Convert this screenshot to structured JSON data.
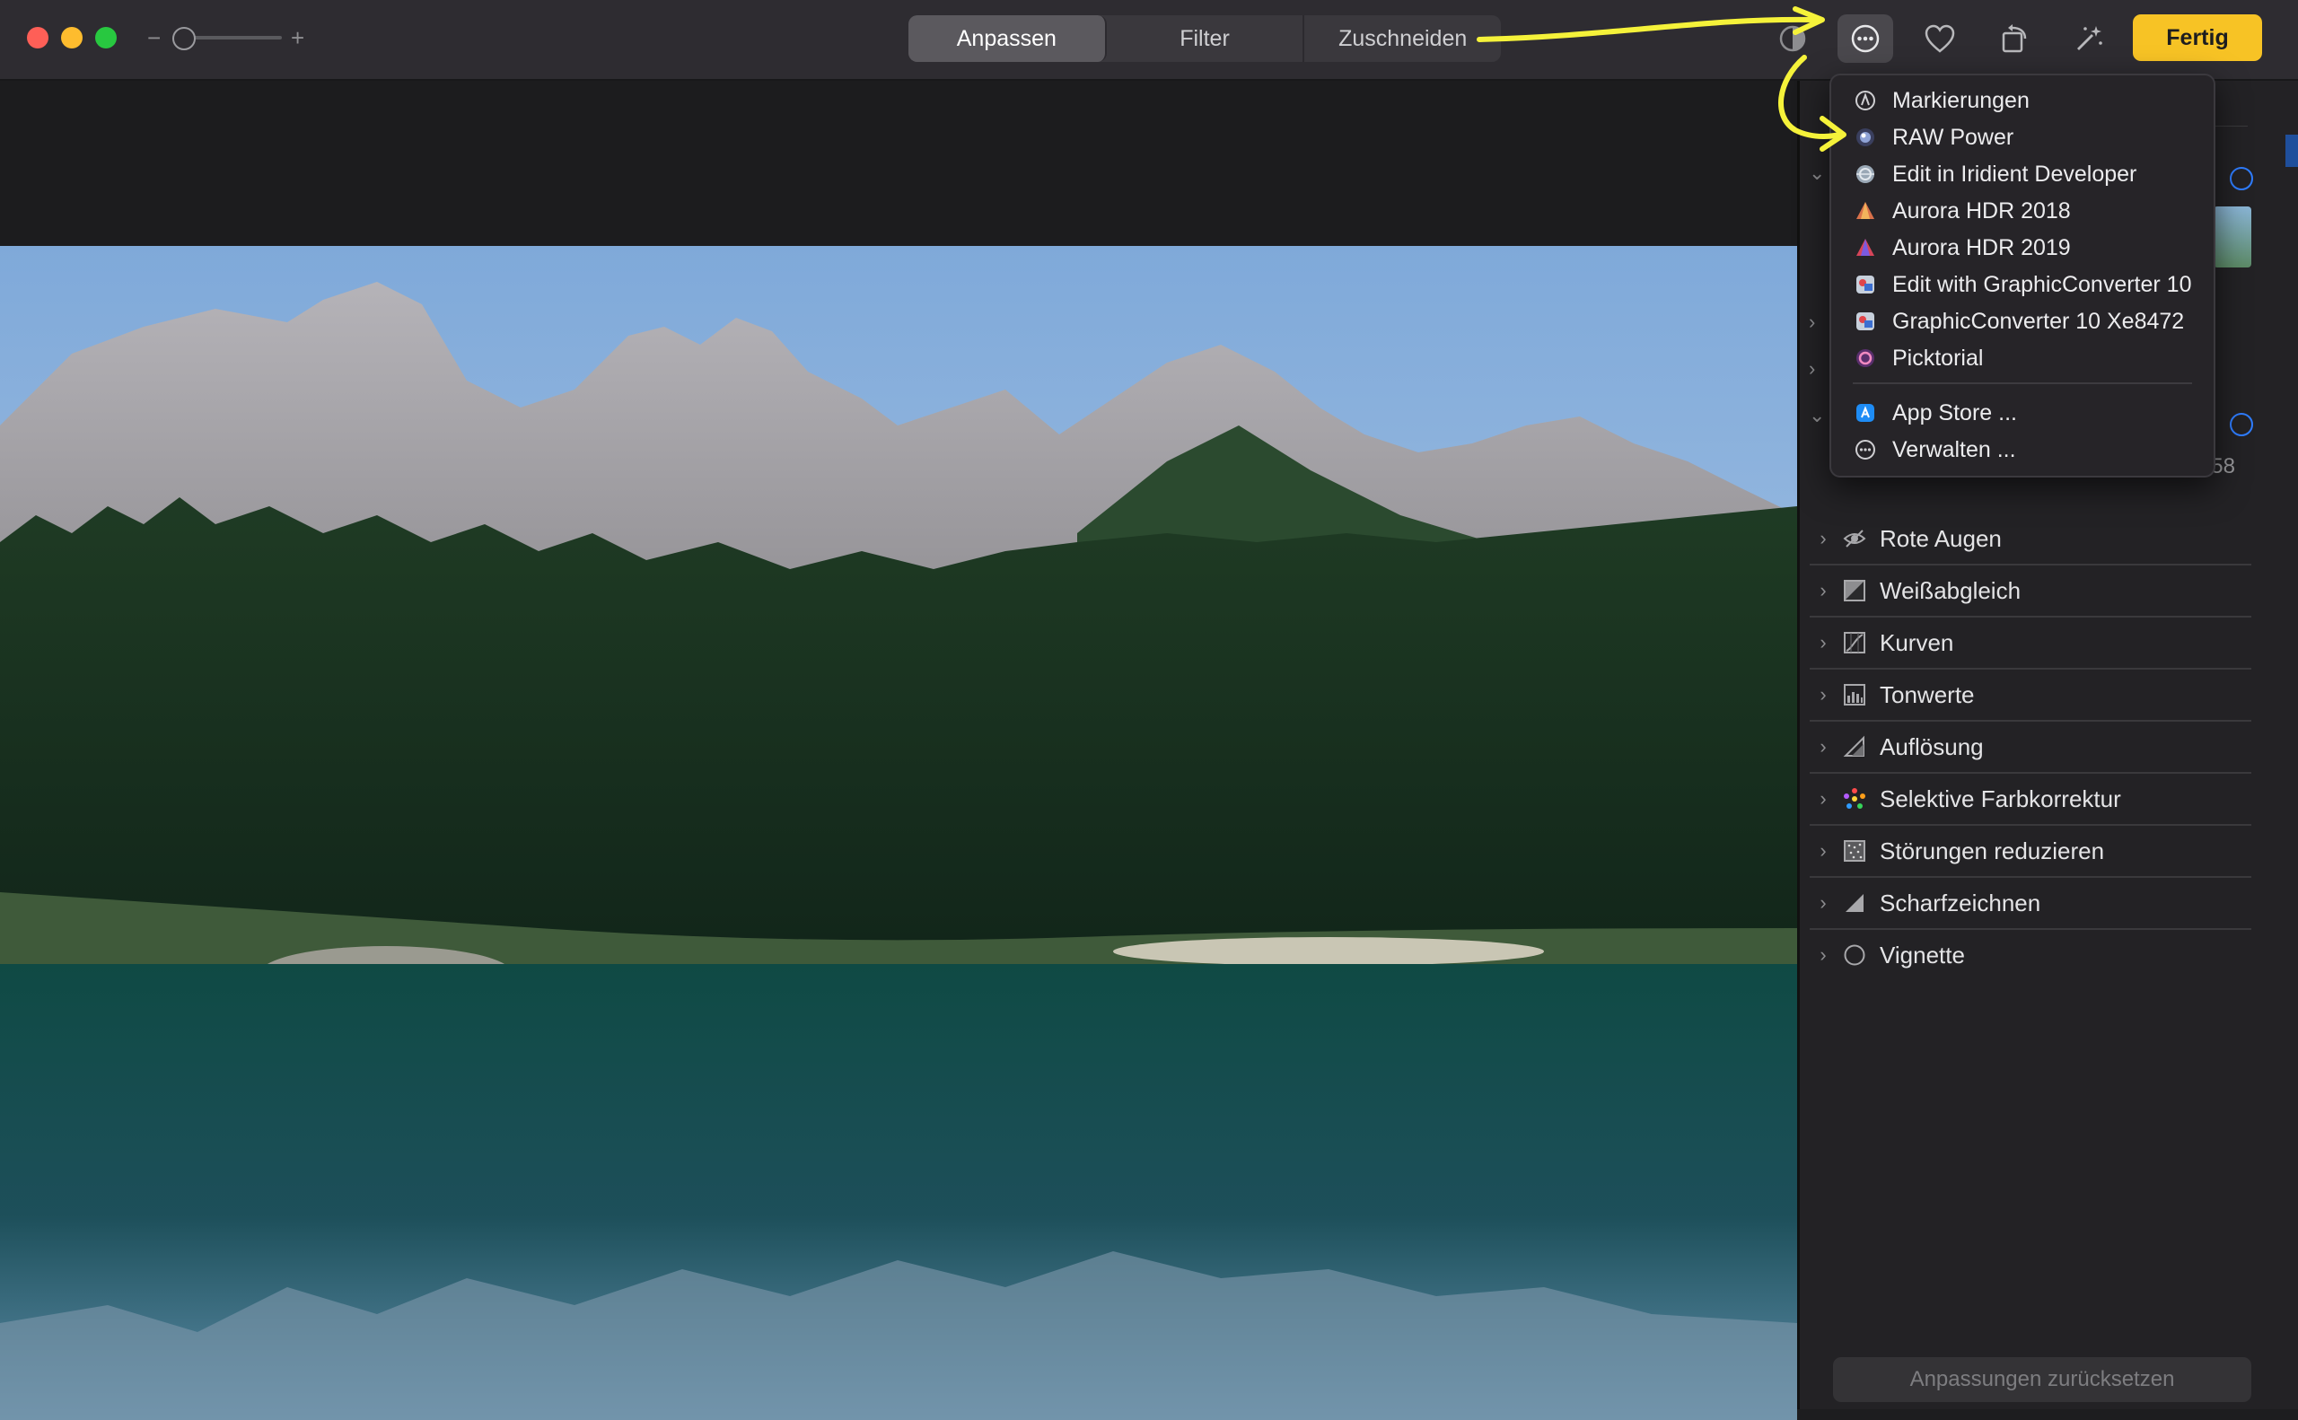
{
  "toolbar": {
    "zoom_minus": "−",
    "zoom_plus": "+",
    "tabs": [
      {
        "label": "Anpassen",
        "active": true
      },
      {
        "label": "Filter",
        "active": false
      },
      {
        "label": "Zuschneiden",
        "active": false
      }
    ],
    "done_label": "Fertig",
    "accent_color": "#f7c325",
    "buttons": [
      "compare-icon",
      "extensions-icon",
      "favorite-heart-icon",
      "rotate-icon",
      "magic-wand-icon"
    ]
  },
  "extensions_menu": {
    "items": [
      {
        "label": "Markierungen",
        "icon": "markup-icon"
      },
      {
        "label": "RAW Power",
        "icon": "raw-power-icon"
      },
      {
        "label": "Edit in Iridient Developer",
        "icon": "iridient-developer-icon"
      },
      {
        "label": "Aurora HDR 2018",
        "icon": "aurora-hdr-2018-icon"
      },
      {
        "label": "Aurora HDR 2019",
        "icon": "aurora-hdr-2019-icon"
      },
      {
        "label": "Edit with GraphicConverter 10",
        "icon": "graphicconverter-icon"
      },
      {
        "label": "GraphicConverter 10 Xe8472",
        "icon": "graphicconverter-icon"
      },
      {
        "label": "Picktorial",
        "icon": "picktorial-icon"
      }
    ],
    "footer_items": [
      {
        "label": "App Store ...",
        "icon": "app-store-icon"
      },
      {
        "label": "Verwalten ...",
        "icon": "more-icon"
      }
    ]
  },
  "sidebar": {
    "slider_value_partial": "4,58",
    "adjustments": [
      {
        "label": "Rote Augen",
        "icon": "red-eye-icon"
      },
      {
        "label": "Weißabgleich",
        "icon": "white-balance-icon"
      },
      {
        "label": "Kurven",
        "icon": "curves-icon"
      },
      {
        "label": "Tonwerte",
        "icon": "levels-icon"
      },
      {
        "label": "Auflösung",
        "icon": "definition-icon"
      },
      {
        "label": "Selektive Farbkorrektur",
        "icon": "selective-color-icon"
      },
      {
        "label": "Störungen reduzieren",
        "icon": "noise-reduction-icon"
      },
      {
        "label": "Scharfzeichnen",
        "icon": "sharpen-icon"
      },
      {
        "label": "Vignette",
        "icon": "vignette-icon"
      }
    ],
    "reset_label": "Anpassungen zurücksetzen"
  },
  "annotation_color": "#f5f23a"
}
